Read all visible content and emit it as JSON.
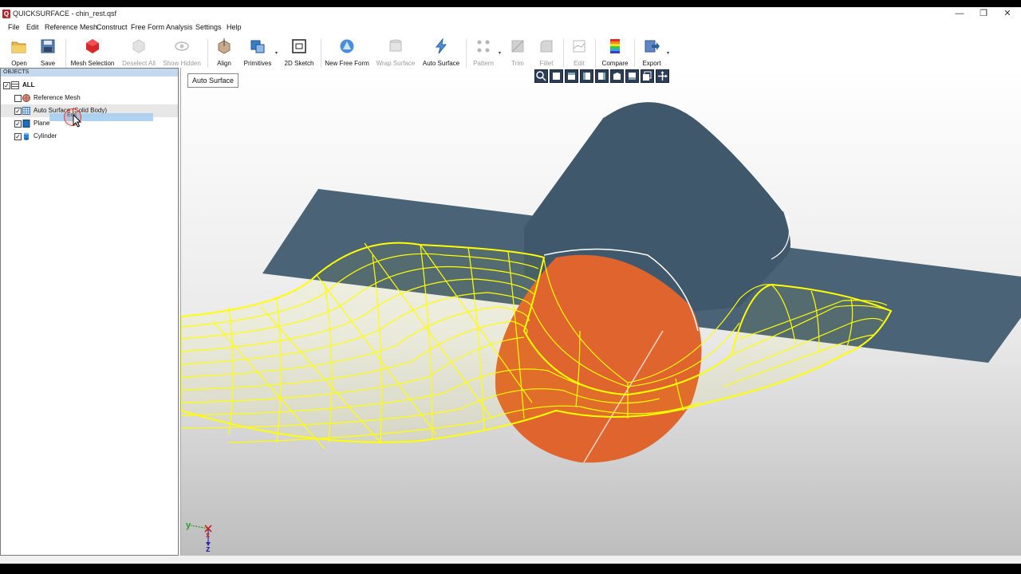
{
  "window": {
    "title": "QUICKSURFACE - chin_rest.qsf",
    "app_icon": "Q",
    "controls": {
      "minimize": "—",
      "restore": "❐",
      "close": "✕"
    }
  },
  "menu": [
    "File",
    "Edit",
    "Reference Mesh",
    "Construct",
    "Free Form",
    "Analysis",
    "Settings",
    "Help"
  ],
  "toolbar": {
    "open": "Open",
    "save": "Save",
    "mesh_selection": "Mesh Selection",
    "deselect_all": "Deselect All",
    "show_hidden": "Show Hidden",
    "align": "Align",
    "primitives": "Primitives",
    "sketch_2d": "2D Sketch",
    "new_free_form": "New Free Form",
    "wrap_surface": "Wrap Surface",
    "auto_surface": "Auto Surface",
    "pattern": "Pattern",
    "trim": "Trim",
    "fillet": "Fillet",
    "edit": "Edit",
    "compare": "Compare",
    "export": "Export",
    "dropdown_caret": "▾"
  },
  "objects_panel": {
    "header": "OBJECTS",
    "root": "ALL",
    "items": [
      {
        "label": "Reference Mesh",
        "checked": false,
        "icon": "mesh-icon"
      },
      {
        "label": "Auto Surface (Solid Body)",
        "checked": true,
        "icon": "grid-surface-icon"
      },
      {
        "label": "Plane",
        "checked": true,
        "icon": "plane-icon"
      },
      {
        "label": "Cylinder",
        "checked": true,
        "icon": "cylinder-icon"
      }
    ],
    "check_mark": "✓",
    "drag_ghost_label": "Edit"
  },
  "viewport": {
    "mode_label": "Auto Surface",
    "axis_labels": {
      "y": "y",
      "x": "x",
      "z": "z"
    },
    "colors": {
      "plane": "#4a6377",
      "cylinder": "#3f586b",
      "cut_face": "#e0642e",
      "wireframe": "#ffff00",
      "edge": "#ffffff"
    }
  }
}
